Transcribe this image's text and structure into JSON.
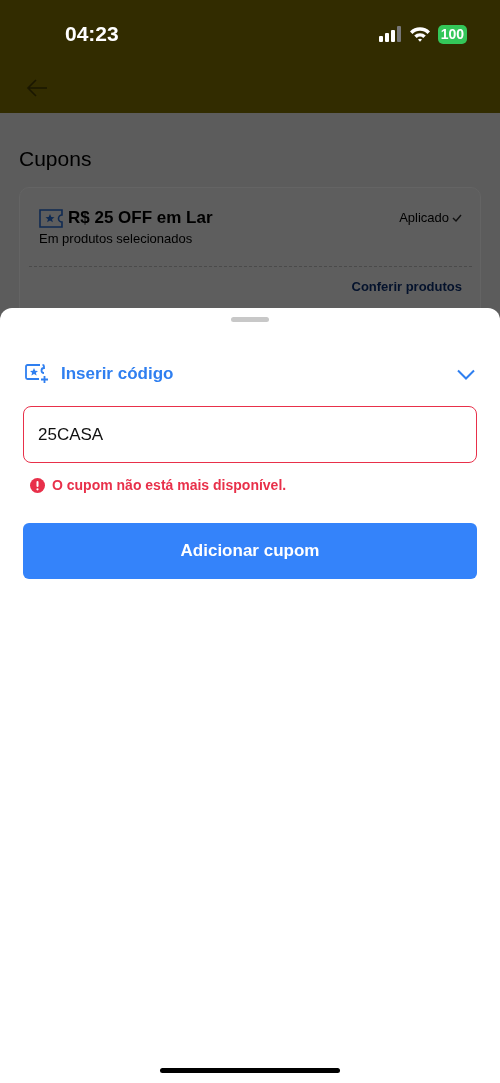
{
  "status_bar": {
    "time": "04:23",
    "battery": "100"
  },
  "page": {
    "title": "Cupons"
  },
  "applied_coupon": {
    "title": "R$ 25 OFF em Lar",
    "subtitle": "Em produtos selecionados",
    "status": "Aplicado",
    "link": "Conferir produtos"
  },
  "sheet": {
    "section_title": "Inserir código",
    "expanded": true,
    "code_field": {
      "value": "25CASA",
      "error": true
    },
    "error_message": "O cupom não está mais disponível.",
    "button": "Adicionar cupom"
  }
}
